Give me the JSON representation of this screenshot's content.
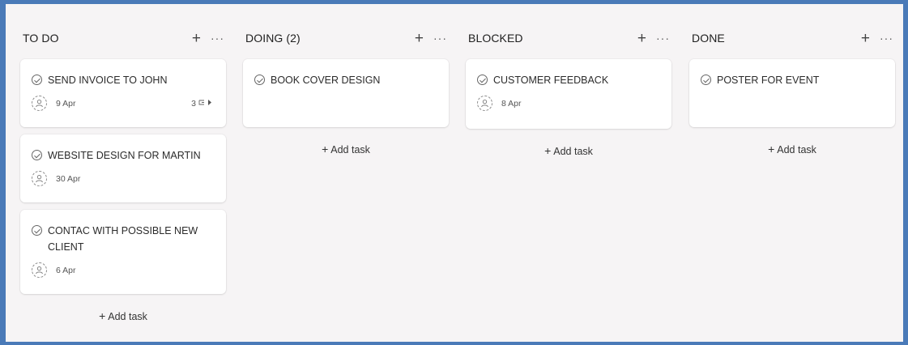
{
  "columns": [
    {
      "title": "TO DO",
      "add_task_label": "Add task",
      "cards": [
        {
          "title": "SEND INVOICE TO JOHN",
          "date": "9 Apr",
          "subtasks": "3"
        },
        {
          "title": "WEBSITE DESIGN FOR MARTIN",
          "date": "30 Apr"
        },
        {
          "title": "CONTAC WITH POSSIBLE NEW CLIENT",
          "date": "6 Apr"
        }
      ]
    },
    {
      "title": "DOING (2)",
      "add_task_label": "Add task",
      "cards": [
        {
          "title": "BOOK COVER DESIGN"
        }
      ]
    },
    {
      "title": "BLOCKED",
      "add_task_label": "Add task",
      "cards": [
        {
          "title": "CUSTOMER FEEDBACK",
          "date": "8 Apr"
        }
      ]
    },
    {
      "title": "DONE",
      "add_task_label": "Add task",
      "cards": [
        {
          "title": "POSTER FOR EVENT"
        }
      ]
    }
  ],
  "icons": {
    "add": "plus-icon",
    "more": "more-horizontal-icon",
    "check": "circle-check-icon",
    "avatar": "unassigned-person-icon",
    "subtask": "subtask-icon"
  },
  "colors": {
    "frame_border": "#4a7ab8",
    "board_background": "#f6f4f5",
    "card_background": "#ffffff"
  }
}
